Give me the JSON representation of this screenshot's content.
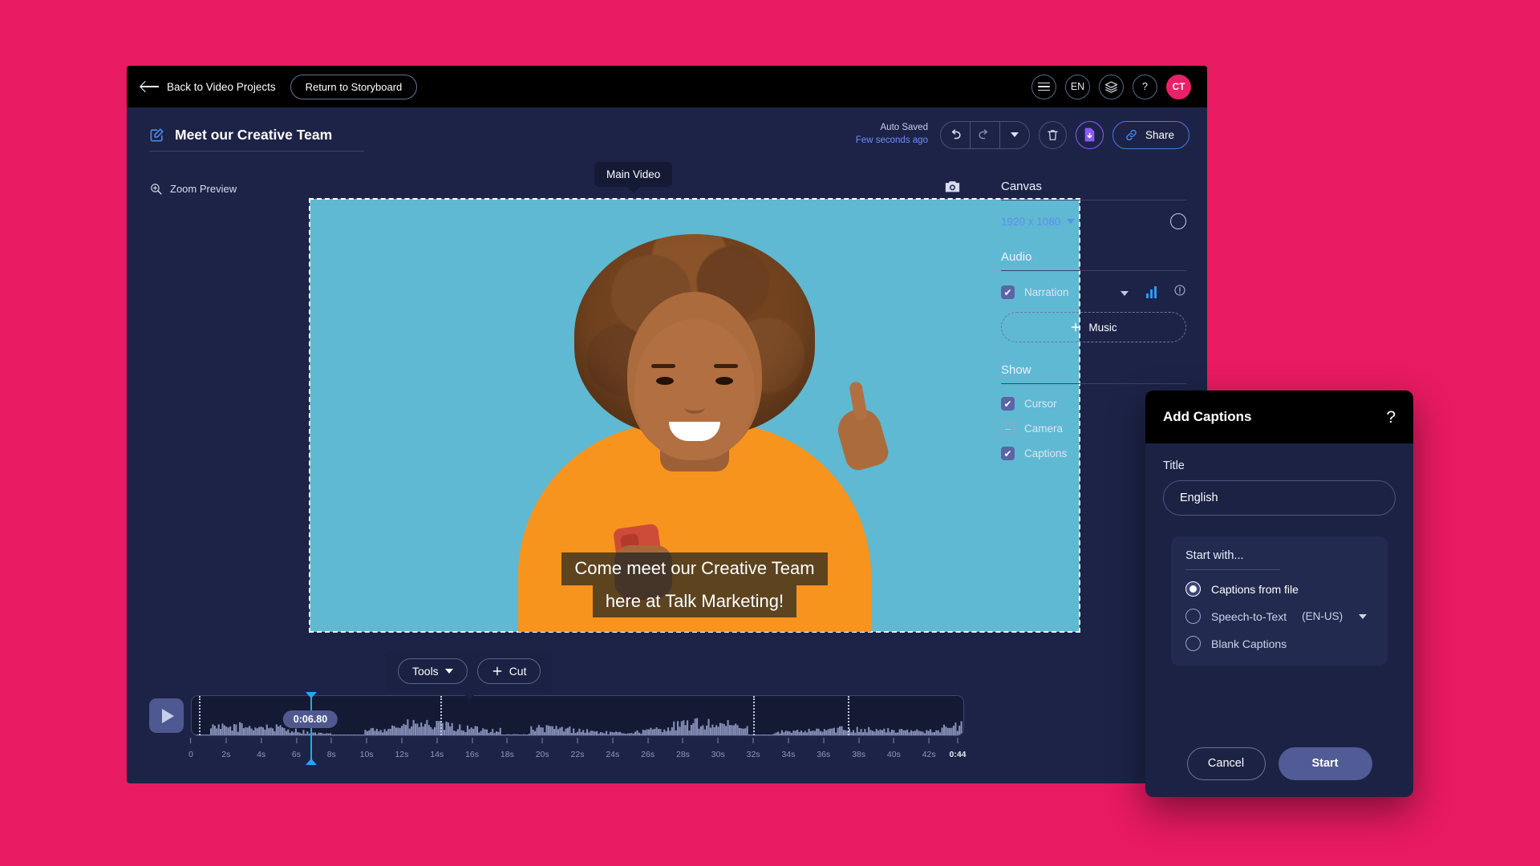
{
  "topbar": {
    "back_label": "Back to Video Projects",
    "return_storyboard": "Return to Storyboard",
    "lang_badge": "EN",
    "help_glyph": "?",
    "avatar_initials": "CT"
  },
  "titlebar": {
    "project_title": "Meet our Creative Team",
    "autosave_line1": "Auto Saved",
    "autosave_line2": "Few seconds ago",
    "share_label": "Share"
  },
  "preview": {
    "zoom_preview_label": "Zoom Preview",
    "main_video_tooltip": "Main Video",
    "caption_line1": "Come meet our Creative Team",
    "caption_line2": "here at Talk Marketing!",
    "tools_label": "Tools",
    "cut_label": "Cut"
  },
  "timeline": {
    "current_time": "0:06.80",
    "playhead_seconds": 6.8,
    "total_seconds": 44,
    "end_label": "0:44",
    "start_label": "0",
    "ticks": [
      "0",
      "2s",
      "4s",
      "6s",
      "8s",
      "10s",
      "12s",
      "14s",
      "16s",
      "18s",
      "20s",
      "22s",
      "24s",
      "26s",
      "28s",
      "30s",
      "32s",
      "34s",
      "36s",
      "38s",
      "40s",
      "42s"
    ],
    "cut_markers": [
      0.4,
      14.2,
      32.0,
      37.4
    ]
  },
  "right_panel": {
    "canvas_heading": "Canvas",
    "canvas_size": "1920 x 1080",
    "audio_heading": "Audio",
    "narration_label": "Narration",
    "music_label": "Music",
    "show_heading": "Show",
    "show_items": [
      {
        "label": "Cursor",
        "state": "checked"
      },
      {
        "label": "Camera",
        "state": "indeterminate"
      },
      {
        "label": "Captions",
        "state": "checked"
      }
    ]
  },
  "dialog": {
    "title": "Add Captions",
    "help_glyph": "?",
    "title_field_label": "Title",
    "title_field_value": "English",
    "title_field_placeholder": "English",
    "start_with_label": "Start with...",
    "options": [
      {
        "label": "Captions from file",
        "extra": "",
        "selected": true
      },
      {
        "label": "Speech-to-Text",
        "extra": "(EN-US)",
        "selected": false
      },
      {
        "label": "Blank Captions",
        "extra": "",
        "selected": false
      }
    ],
    "cancel_label": "Cancel",
    "start_label": "Start"
  },
  "colors": {
    "page_background": "#e81a62",
    "app_background": "#1d2347",
    "topbar": "#000000",
    "accent_blue": "#5e8df0",
    "accent_pink": "#ec1f69",
    "playhead": "#23a8f2",
    "video_background": "#5fb9d2",
    "shirt": "#f7941d"
  }
}
